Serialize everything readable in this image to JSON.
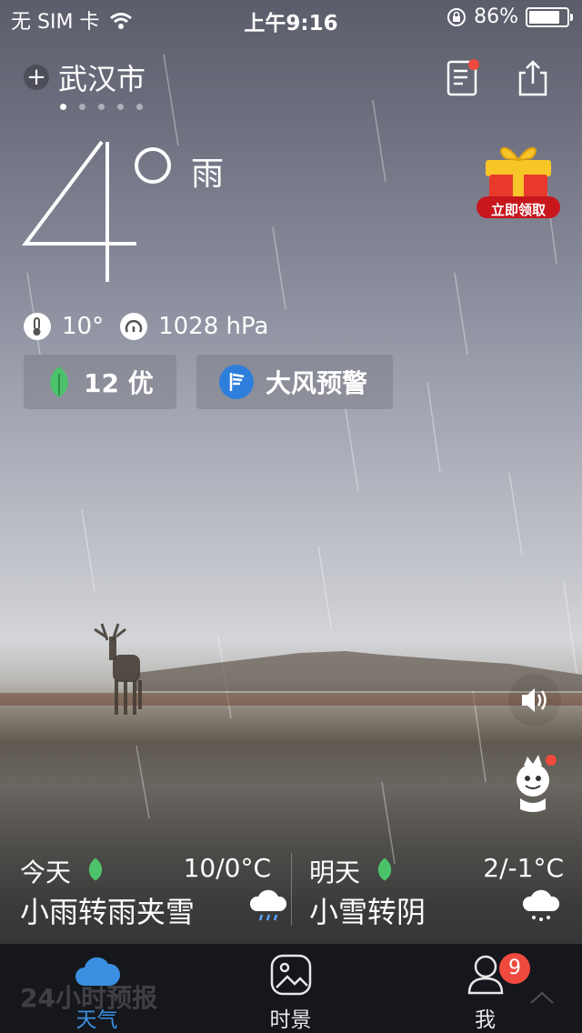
{
  "status_bar": {
    "carrier": "无 SIM 卡",
    "time": "上午9:16",
    "battery": "86%",
    "battery_level": 0.86
  },
  "header": {
    "city": "武汉市",
    "page_count": 5,
    "active_page": 1
  },
  "current": {
    "temperature": "4",
    "condition": "雨",
    "feels_like": "10°",
    "pressure": "1028 hPa"
  },
  "promo": {
    "label": "立即领取"
  },
  "chips": {
    "aqi": "12 优",
    "alert": "大风预警"
  },
  "forecast": {
    "today": {
      "day": "今天",
      "range": "10/0°C",
      "desc": "小雨转雨夹雪"
    },
    "tomorrow": {
      "day": "明天",
      "range": "2/-1°C",
      "desc": "小雪转阴"
    }
  },
  "hourly_label": "24小时预报",
  "tabbar": {
    "tabs": [
      {
        "label": "天气"
      },
      {
        "label": "时景"
      },
      {
        "label": "我"
      }
    ],
    "me_badge": "9"
  },
  "colors": {
    "accent_blue": "#3a8fe0",
    "leaf_green": "#4cc36a",
    "badge_red": "#f04a3e"
  }
}
